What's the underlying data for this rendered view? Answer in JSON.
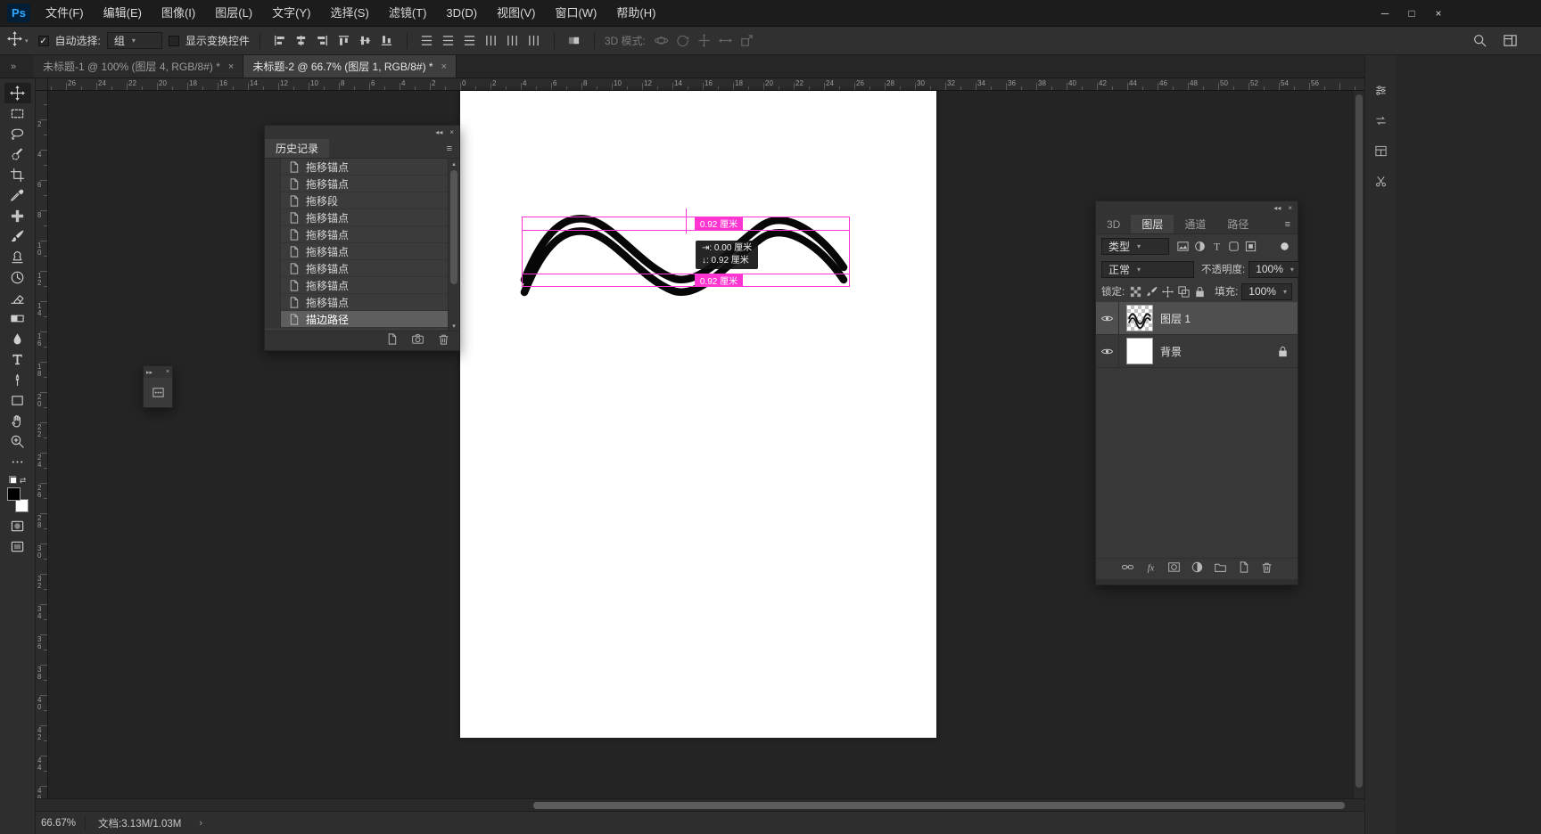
{
  "colors": {
    "magenta": "#ff35d2",
    "logo_bg": "#001e36",
    "logo_text": "#31a8ff"
  },
  "menu_bar": {
    "logo": "Ps",
    "items": [
      "文件(F)",
      "编辑(E)",
      "图像(I)",
      "图层(L)",
      "文字(Y)",
      "选择(S)",
      "滤镜(T)",
      "3D(D)",
      "视图(V)",
      "窗口(W)",
      "帮助(H)"
    ]
  },
  "window_controls": {
    "minimize": "─",
    "maximize": "□",
    "close": "×"
  },
  "icons_text": {
    "close": "×",
    "chevron_down": "▾",
    "collapse_left": "◂◂",
    "collapse_right": "»",
    "mini_collapse": "▸▸",
    "panel_menu": "≡",
    "scroll_up": "▴",
    "scroll_down": "▾",
    "check": "✓",
    "swap": "⇄",
    "status_chevron": "›"
  },
  "options_bar": {
    "auto_select_label": "自动选择:",
    "auto_select_checked": true,
    "target_value": "组",
    "show_transform_label": "显示变换控件",
    "show_transform_checked": false,
    "align_icons": [
      "align-left-edges",
      "align-horizontal-centers",
      "align-right-edges",
      "align-top-edges",
      "align-vertical-centers",
      "align-bottom-edges"
    ],
    "distribute_icons": [
      "distribute-top-edges",
      "distribute-vertical-centers",
      "distribute-bottom-edges",
      "distribute-left-edges",
      "distribute-horizontal-centers",
      "distribute-right-edges"
    ],
    "auto_align_icon": "auto-align-layers",
    "mode_3d_label": "3D 模式:",
    "mode_3d_icons": [
      "3d-orbit",
      "3d-roll",
      "3d-pan",
      "3d-slide",
      "3d-scale"
    ]
  },
  "document_tabs": [
    {
      "title": "未标题-1 @ 100% (图层 4, RGB/8#) *",
      "active": false
    },
    {
      "title": "未标题-2 @ 66.7% (图层 1, RGB/8#) *",
      "active": true
    }
  ],
  "toolbar": {
    "tools": [
      {
        "name": "move",
        "selected": true
      },
      {
        "name": "rectangular-marquee"
      },
      {
        "name": "lasso"
      },
      {
        "name": "quick-selection"
      },
      {
        "name": "crop"
      },
      {
        "name": "eyedropper"
      },
      {
        "name": "spot-healing-brush"
      },
      {
        "name": "brush"
      },
      {
        "name": "clone-stamp"
      },
      {
        "name": "history-brush"
      },
      {
        "name": "eraser"
      },
      {
        "name": "gradient"
      },
      {
        "name": "blur"
      },
      {
        "name": "type"
      },
      {
        "name": "pen"
      },
      {
        "name": "rectangle"
      },
      {
        "name": "hand"
      },
      {
        "name": "zoom"
      },
      {
        "name": "edit-toolbar"
      }
    ]
  },
  "rulers": {
    "h_labels": [
      "26",
      "24",
      "22",
      "20",
      "18",
      "16",
      "14",
      "12",
      "10",
      "8",
      "6",
      "4",
      "2",
      "0",
      "2",
      "4",
      "6",
      "8",
      "10",
      "12",
      "14",
      "16",
      "18",
      "20",
      "22",
      "24",
      "26",
      "28",
      "30",
      "32",
      "34",
      "36",
      "38",
      "40",
      "42",
      "44",
      "46",
      "48",
      "50",
      "52",
      "54",
      "56"
    ],
    "v_labels": [
      "2",
      "4",
      "6",
      "8",
      "10",
      "12",
      "14",
      "16",
      "18",
      "20",
      "22",
      "24",
      "26",
      "28",
      "30",
      "32",
      "34",
      "36",
      "38",
      "40",
      "42",
      "44",
      "46"
    ]
  },
  "history_panel": {
    "title": "历史记录",
    "items": [
      {
        "label": "拖移锚点"
      },
      {
        "label": "拖移锚点"
      },
      {
        "label": "拖移段"
      },
      {
        "label": "拖移锚点"
      },
      {
        "label": "拖移锚点"
      },
      {
        "label": "拖移锚点"
      },
      {
        "label": "拖移锚点"
      },
      {
        "label": "拖移锚点"
      },
      {
        "label": "拖移锚点"
      },
      {
        "label": "描边路径",
        "selected": true
      }
    ]
  },
  "canvas_overlay": {
    "badge_top": "0.92 厘米",
    "badge_bottom": "0.92 厘米",
    "tooltip_line1": "⇥:  0.00  厘米",
    "tooltip_line2": "↓:  0.92  厘米"
  },
  "layers_panel": {
    "tabs": [
      {
        "label": "3D"
      },
      {
        "label": "图层",
        "active": true
      },
      {
        "label": "通道"
      },
      {
        "label": "路径"
      }
    ],
    "filter_label": "类型",
    "filter_icons": [
      "pixel-layer-filter",
      "adjustment-layer-filter",
      "type-layer-filter",
      "shape-layer-filter",
      "smart-object-filter"
    ],
    "blend_mode": "正常",
    "opacity_label": "不透明度:",
    "opacity_value": "100%",
    "lock_label": "锁定:",
    "lock_icons": [
      "lock-transparent-pixels",
      "lock-image-pixels",
      "lock-position",
      "lock-artboard",
      "lock-all"
    ],
    "fill_label": "填充:",
    "fill_value": "100%",
    "layers": [
      {
        "name": "图层 1",
        "selected": true,
        "thumb": "checker"
      },
      {
        "name": "背景",
        "locked": true,
        "thumb": "white"
      }
    ]
  },
  "status_bar": {
    "zoom": "66.67%",
    "doc_info": "文档:3.13M/1.03M"
  },
  "dock": {
    "icons": [
      "dock-panel-1",
      "dock-panel-2",
      "dock-panel-3",
      "dock-panel-4"
    ]
  }
}
